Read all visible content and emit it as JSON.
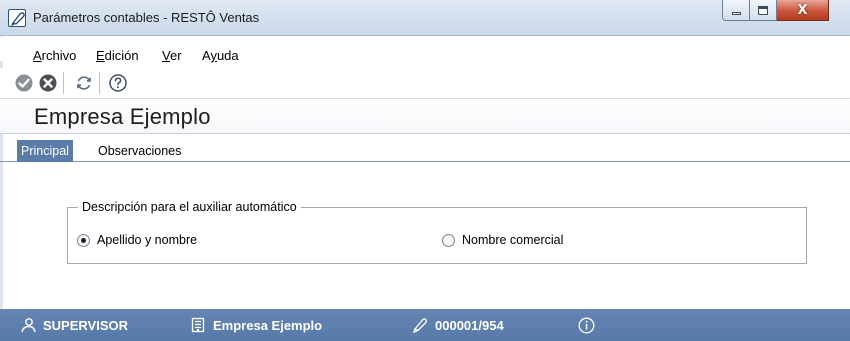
{
  "window": {
    "title": "Parámetros contables - RESTÔ Ventas",
    "close_glyph": "X"
  },
  "menu": {
    "items": [
      {
        "mnemonic": "A",
        "rest": "rchivo"
      },
      {
        "mnemonic": "E",
        "rest": "dición"
      },
      {
        "mnemonic": "V",
        "rest": "er"
      },
      {
        "mnemonic": "",
        "pre": "A",
        "mid": "y",
        "post": "uda"
      }
    ]
  },
  "toolbar": {
    "icons": [
      "accept-icon",
      "cancel-icon",
      "refresh-icon",
      "help-icon"
    ]
  },
  "heading": "Empresa Ejemplo",
  "tabs": [
    {
      "label": "Principal",
      "active": true
    },
    {
      "label": "Observaciones",
      "active": false
    }
  ],
  "group": {
    "legend": "Descripción para el auxiliar automático",
    "options": [
      {
        "label": "Apellido y nombre",
        "checked": true
      },
      {
        "label": "Nombre comercial",
        "checked": false
      }
    ]
  },
  "status": {
    "user": "SUPERVISOR",
    "company": "Empresa Ejemplo",
    "code": "000001/954"
  },
  "colors": {
    "status_bar": "#5b7eaa",
    "tab_active": "#5a7ca8",
    "close_button": "#c9553a"
  }
}
